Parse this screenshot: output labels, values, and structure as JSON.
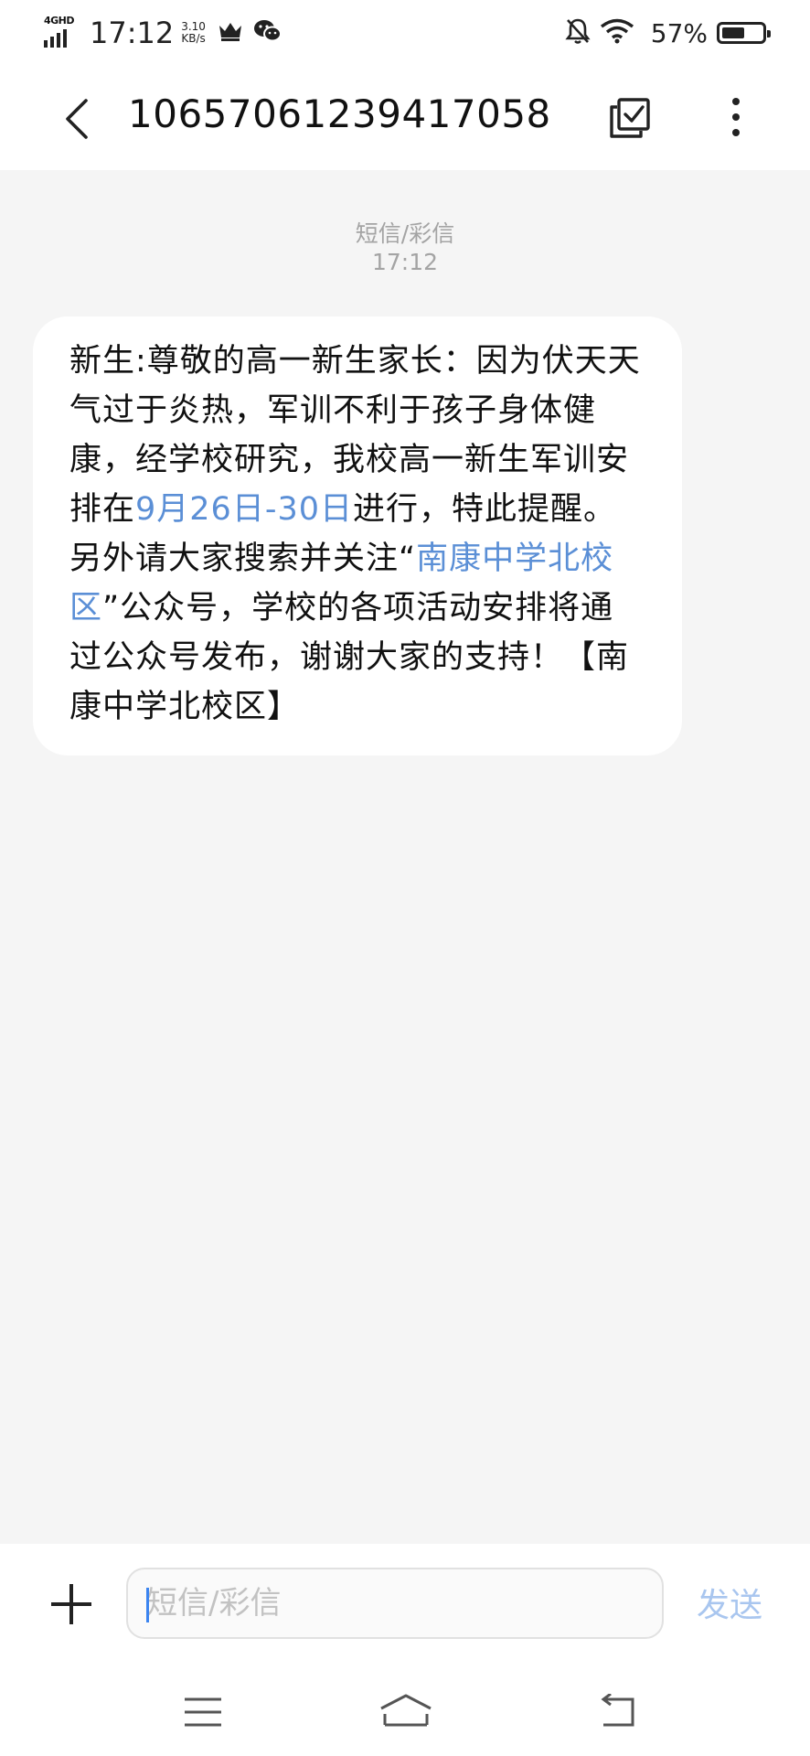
{
  "status_bar": {
    "network": "4GHD",
    "time": "17:12",
    "speed_value": "3.10",
    "speed_unit": "KB/s",
    "battery_pct": "57%",
    "battery_level": 0.57
  },
  "header": {
    "title": "10657061239417058"
  },
  "conversation": {
    "meta_type": "短信/彩信",
    "meta_time": "17:12",
    "message": {
      "part1": "新生:尊敬的高一新生家长：因为伏天天气过于炎热，军训不利于孩子身体健康，经学校研究，我校高一新生军训安排在",
      "link_date": "9月26日-30日",
      "part2": "进行，特此提醒。另外请大家搜索并关注“",
      "link_name": "南康中学北校区",
      "part3": "”公众号，学校的各项活动安排将通过公众号发布，谢谢大家的支持！【南康中学北校区】"
    }
  },
  "composer": {
    "placeholder": "短信/彩信",
    "send_label": "发送"
  },
  "colors": {
    "link": "#5b8fd6",
    "send_disabled": "#a9c6ef",
    "background": "#f5f5f5"
  }
}
